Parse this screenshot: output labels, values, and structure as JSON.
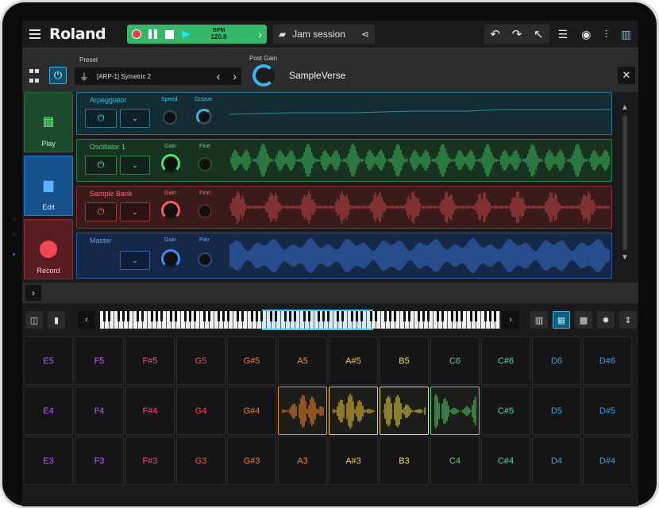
{
  "app": {
    "logo": "Roland",
    "bpm_label": "BPM",
    "bpm_value": "120.0",
    "session_name": "Jam session"
  },
  "strip": {
    "preset_label": "Preset",
    "preset_value": "[ARP-1] Symetric 2",
    "post_gain_label": "Post Gain",
    "name": "SampleVerse"
  },
  "modes": [
    {
      "label": "Play"
    },
    {
      "label": "Edit"
    },
    {
      "label": "Record"
    }
  ],
  "tracks": {
    "arp": {
      "name": "Arpeggiator",
      "k1": "Speed",
      "k2": "Octave"
    },
    "osc": {
      "name": "Oscillator 1",
      "k1": "Gain",
      "k2": "Fine"
    },
    "smp": {
      "name": "Sample Bank",
      "k1": "Gain",
      "k2": "Fine"
    },
    "mst": {
      "name": "Master",
      "k1": "Gain",
      "k2": "Pan"
    }
  },
  "colors": {
    "transport": "#35b86a",
    "accent": "#3cc7ff",
    "osc": "#4fdc6e",
    "sample": "#ff6b6b",
    "master": "#5aa2ff"
  },
  "pads": [
    {
      "note": "E5",
      "color": "#b35cff"
    },
    {
      "note": "F5",
      "color": "#c15cff"
    },
    {
      "note": "F#5",
      "color": "#ff4f6a"
    },
    {
      "note": "G5",
      "color": "#ff4f4f"
    },
    {
      "note": "G#5",
      "color": "#ff7a2e"
    },
    {
      "note": "A5",
      "color": "#ff8a2e"
    },
    {
      "note": "A#5",
      "color": "#ffd02e"
    },
    {
      "note": "B5",
      "color": "#f5e34a"
    },
    {
      "note": "C6",
      "color": "#4fdc6e"
    },
    {
      "note": "C#6",
      "color": "#3fe0a0"
    },
    {
      "note": "D6",
      "color": "#3aa8d8"
    },
    {
      "note": "D#6",
      "color": "#3a9ee8"
    },
    {
      "note": "E4",
      "color": "#b35cff"
    },
    {
      "note": "F4",
      "color": "#c15cff"
    },
    {
      "note": "F#4",
      "color": "#ff4f6a"
    },
    {
      "note": "G4",
      "color": "#ff4f4f"
    },
    {
      "note": "G#4",
      "color": "#ff7a2e"
    },
    {
      "note": "",
      "color": "#ff8a2e",
      "wave": true
    },
    {
      "note": "",
      "color": "#ffd02e",
      "wave": true
    },
    {
      "note": "",
      "color": "#f5e34a",
      "wave": true
    },
    {
      "note": "",
      "color": "#4fdc6e",
      "wave": true
    },
    {
      "note": "C#5",
      "color": "#3fe0a0"
    },
    {
      "note": "D5",
      "color": "#3aa8d8"
    },
    {
      "note": "D#5",
      "color": "#3a9ee8"
    },
    {
      "note": "E3",
      "color": "#b35cff"
    },
    {
      "note": "F3",
      "color": "#c15cff"
    },
    {
      "note": "F#3",
      "color": "#ff4f6a"
    },
    {
      "note": "G3",
      "color": "#ff4f4f"
    },
    {
      "note": "G#3",
      "color": "#ff7a2e"
    },
    {
      "note": "A3",
      "color": "#ff8a2e"
    },
    {
      "note": "A#3",
      "color": "#ffd02e"
    },
    {
      "note": "B3",
      "color": "#f5e34a"
    },
    {
      "note": "C4",
      "color": "#4fdc6e"
    },
    {
      "note": "C#4",
      "color": "#3fe0a0"
    },
    {
      "note": "D4",
      "color": "#3aa8d8"
    },
    {
      "note": "D#4",
      "color": "#3a9ee8"
    }
  ]
}
